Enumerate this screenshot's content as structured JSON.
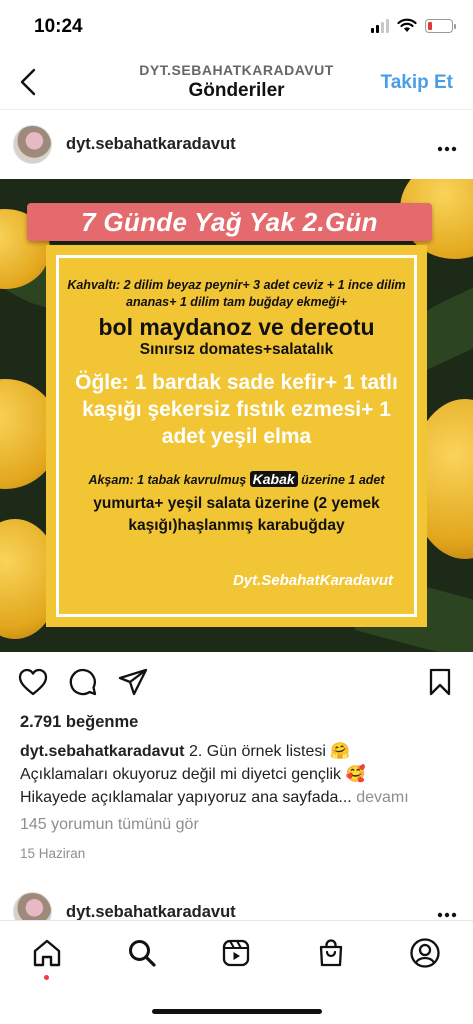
{
  "status_bar": {
    "time": "10:24"
  },
  "header": {
    "subtitle": "DYT.SEBAHATKARADAVUT",
    "title": "Gönderiler",
    "follow_label": "Takip Et"
  },
  "post": {
    "username": "dyt.sebahatkaradavut",
    "image": {
      "title": "7 Günde Yağ Yak 2.Gün",
      "breakfast": "Kahvaltı: 2 dilim beyaz peynir+ 3 adet ceviz + 1 ince dilim ananas+ 1 dilim tam buğday ekmeği+",
      "parsley": "bol maydanoz ve dereotu",
      "tomato": "Sınırsız domates+salatalık",
      "lunch": "Öğle: 1 bardak sade kefir+ 1 tatlı kaşığı şekersiz fıstık ezmesi+ 1 adet yeşil elma",
      "dinner_prefix": "Akşam: 1 tabak kavrulmuş",
      "dinner_highlight": "Kabak",
      "dinner_suffix": "üzerine 1 adet",
      "dinner_rest": "yumurta+ yeşil salata üzerine (2 yemek kaşığı)haşlanmış karabuğday",
      "signature": "Dyt.SebahatKaradavut"
    },
    "likes": "2.791 beğenme",
    "caption": {
      "username": "dyt.sebahatkaradavut",
      "line1": " 2. Gün örnek listesi 🤗",
      "line2": "Açıklamaları okuyoruz değil mi diyetci gençlik 🥰",
      "line3": "Hikayede açıklamalar yapıyoruz ana sayfada...",
      "more": "devamı"
    },
    "comments_link": "145 yorumun tümünü gör",
    "date": "15 Haziran"
  },
  "next_post": {
    "username": "dyt.sebahatkaradavut"
  },
  "icons": {
    "back": "chevron-left-icon",
    "more": "more-horizontal-icon",
    "like": "heart-icon",
    "comment": "comment-icon",
    "share": "send-icon",
    "save": "bookmark-icon",
    "home": "home-icon",
    "search": "search-icon",
    "reels": "reels-icon",
    "shop": "shop-icon",
    "profile": "profile-icon"
  },
  "colors": {
    "accent": "#4a9ee6",
    "banner": "#e56a6d",
    "panel": "#f2c534",
    "notification_dot": "#ee3b4d"
  }
}
